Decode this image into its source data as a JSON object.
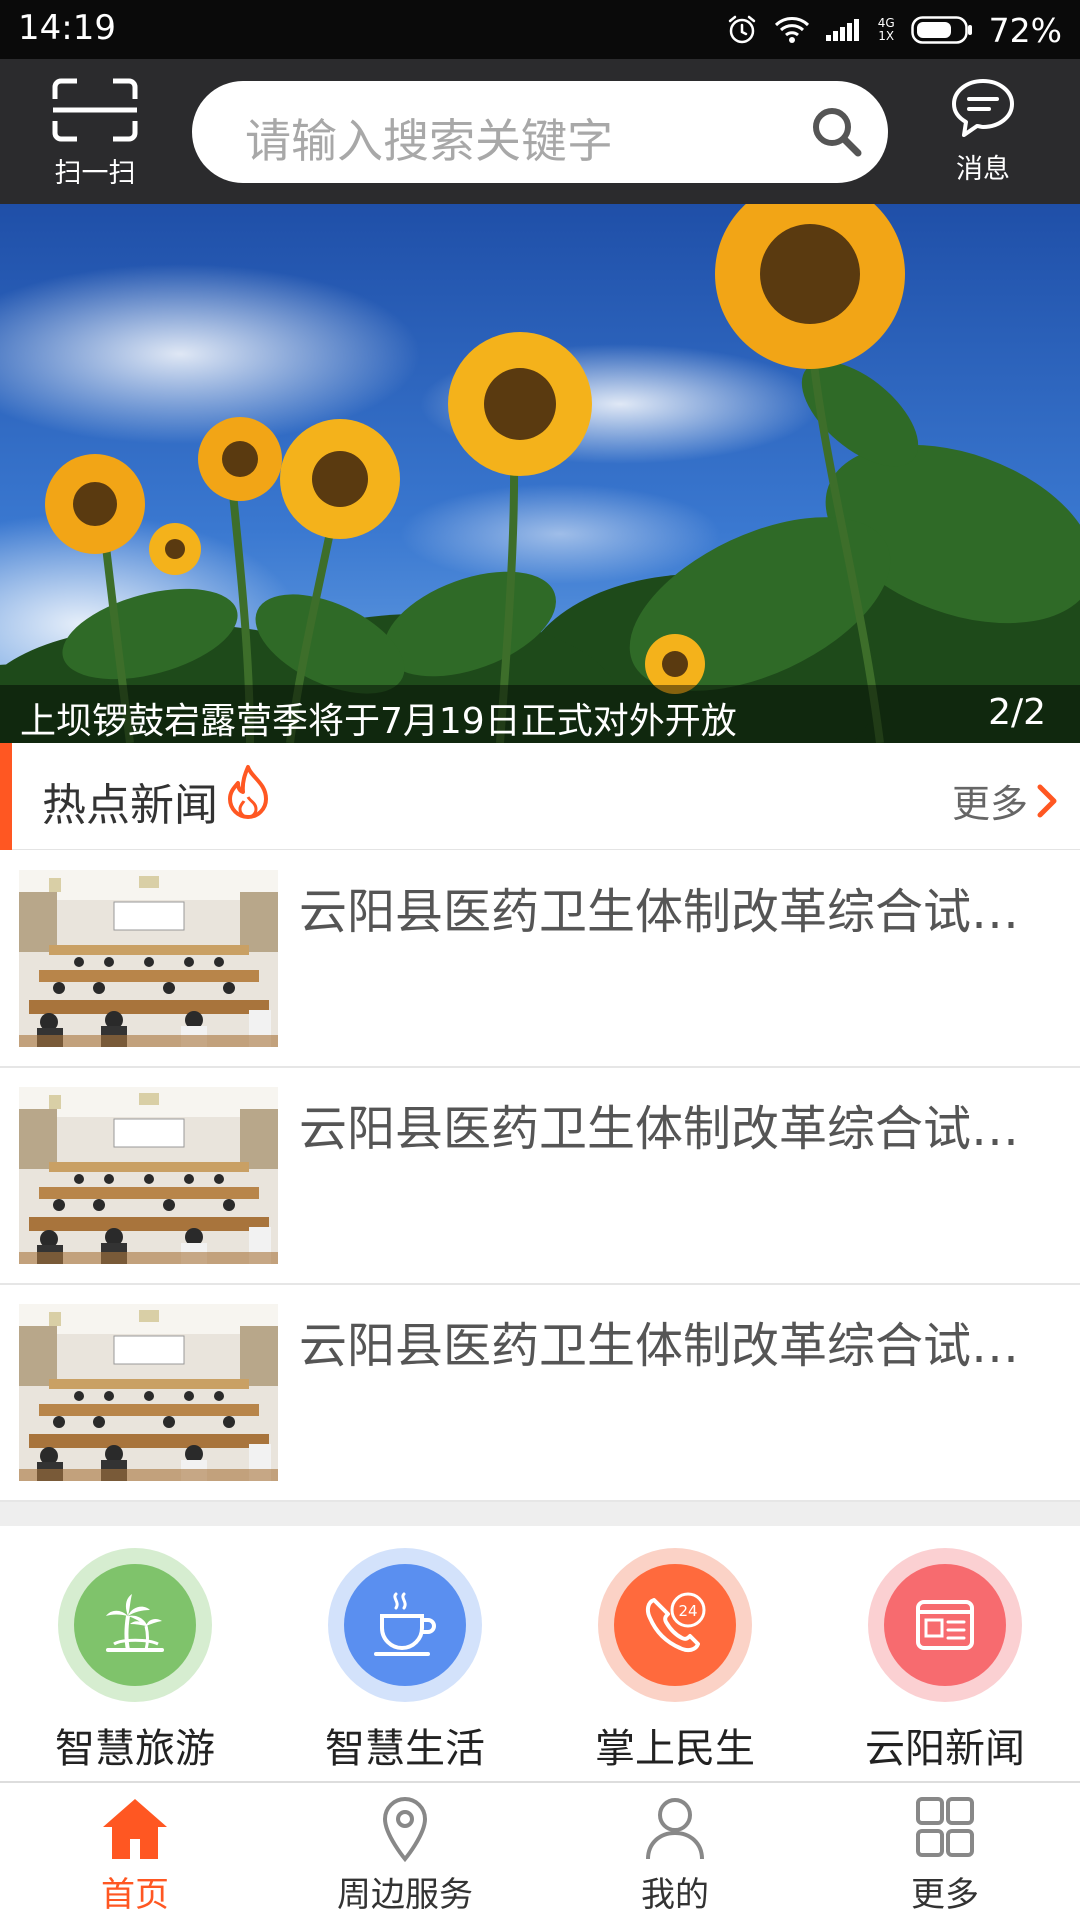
{
  "status_bar": {
    "time": "14:19",
    "network_type_top": "4G",
    "network_type_bottom": "1X",
    "battery_percent": "72%"
  },
  "header": {
    "scan_label": "扫一扫",
    "search_placeholder": "请输入搜索关键字",
    "message_label": "消息"
  },
  "banner": {
    "caption": "上坝锣鼓宕露营季将于7月19日正式对外开放",
    "index": "2/2"
  },
  "hot_news": {
    "title": "热点新闻",
    "more_label": "更多",
    "items": [
      {
        "title": "云阳县医药卫生体制改革综合试点工作推进会召开"
      },
      {
        "title": "云阳县医药卫生体制改革综合试点工作推进会召开"
      },
      {
        "title": "云阳县医药卫生体制改革综合试点工作推进会召开"
      }
    ]
  },
  "services": [
    {
      "label": "智慧旅游",
      "icon": "palm-tree-icon",
      "ring_color": "#d6edd0",
      "core_color": "#7fc36b"
    },
    {
      "label": "智慧生活",
      "icon": "coffee-cup-icon",
      "ring_color": "#d3e2fb",
      "core_color": "#5a8ff0"
    },
    {
      "label": "掌上民生",
      "icon": "phone-24h-icon",
      "ring_color": "#fbd2c6",
      "core_color": "#ff6a3d"
    },
    {
      "label": "云阳新闻",
      "icon": "newspaper-icon",
      "ring_color": "#fbd0d2",
      "core_color": "#f76b6f"
    }
  ],
  "bottom_nav": [
    {
      "label": "首页",
      "icon": "home-icon",
      "active": true
    },
    {
      "label": "周边服务",
      "icon": "location-pin-icon",
      "active": false
    },
    {
      "label": "我的",
      "icon": "user-icon",
      "active": false
    },
    {
      "label": "更多",
      "icon": "grid-icon",
      "active": false
    }
  ],
  "colors": {
    "accent": "#ff5722",
    "header_bg": "#2b2b2d",
    "status_bg": "#0a0a0a"
  }
}
